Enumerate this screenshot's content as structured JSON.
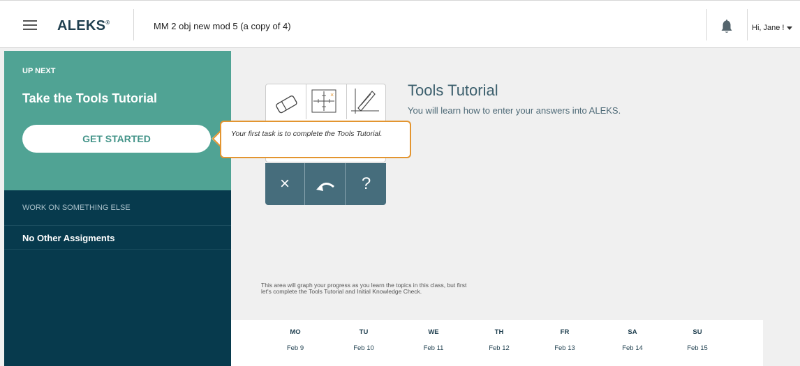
{
  "header": {
    "logo": "ALEKS",
    "logo_mark": "®",
    "class_title": "MM 2 obj new mod 5 (a copy of 4)",
    "user_greeting": "Hi, Jane !"
  },
  "sidebar": {
    "up_next_label": "UP NEXT",
    "task_title": "Take the Tools Tutorial",
    "start_button": "GET STARTED",
    "work_else_label": "WORK ON SOMETHING ELSE",
    "no_assignments": "No Other Assigments"
  },
  "tutorial": {
    "title": "Tools Tutorial",
    "description": "You will learn how to enter your answers into ALEKS.",
    "tool_icons": [
      "eraser-icon",
      "graph-grid-icon",
      "pencil-graph-icon",
      "clear-x-icon",
      "undo-icon",
      "help-icon"
    ]
  },
  "callout": {
    "text": "Your first task is to complete the Tools Tutorial."
  },
  "progress": {
    "note": "This area will graph your progress as you learn the topics in this class, but first let's complete the Tools Tutorial and Initial Knowledge Check."
  },
  "week": [
    {
      "dow": "MO",
      "date": "Feb 9"
    },
    {
      "dow": "TU",
      "date": "Feb 10"
    },
    {
      "dow": "WE",
      "date": "Feb 11"
    },
    {
      "dow": "TH",
      "date": "Feb 12"
    },
    {
      "dow": "FR",
      "date": "Feb 13"
    },
    {
      "dow": "SA",
      "date": "Feb 14"
    },
    {
      "dow": "SU",
      "date": "Feb 15"
    }
  ],
  "colors": {
    "teal": "#50a394",
    "navy": "#073a4d",
    "callout_border": "#e39530",
    "tool_dark": "#466d7c"
  }
}
